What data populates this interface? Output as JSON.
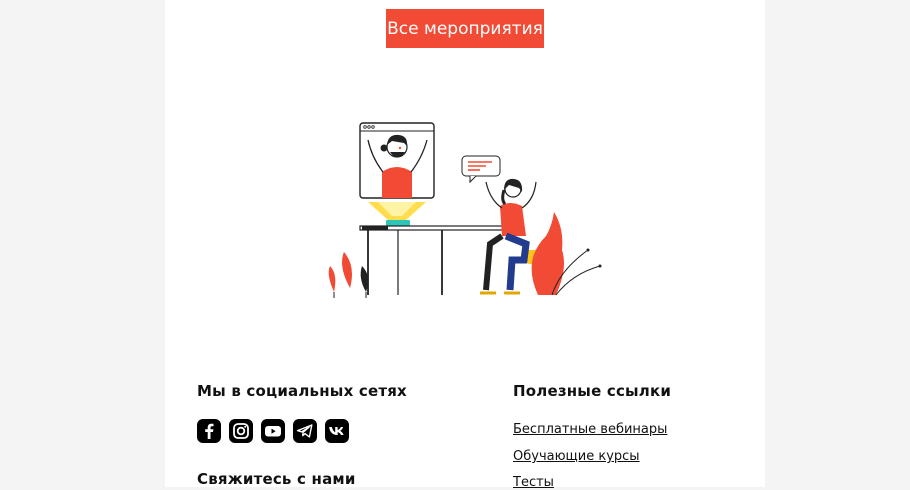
{
  "cta": {
    "label": "Все мероприятия"
  },
  "colors": {
    "accent": "#f24b35",
    "page_bg": "#f4f4f4",
    "sheet_bg": "#ffffff"
  },
  "social": {
    "title": "Мы в социальных сетях",
    "icons": [
      "facebook-icon",
      "instagram-icon",
      "youtube-icon",
      "telegram-icon",
      "vk-icon"
    ]
  },
  "contact": {
    "title": "Свяжитесь с нами"
  },
  "links": {
    "title": "Полезные ссылки",
    "items": [
      "Бесплатные вебинары",
      "Обучающие курсы",
      "Тесты"
    ]
  }
}
